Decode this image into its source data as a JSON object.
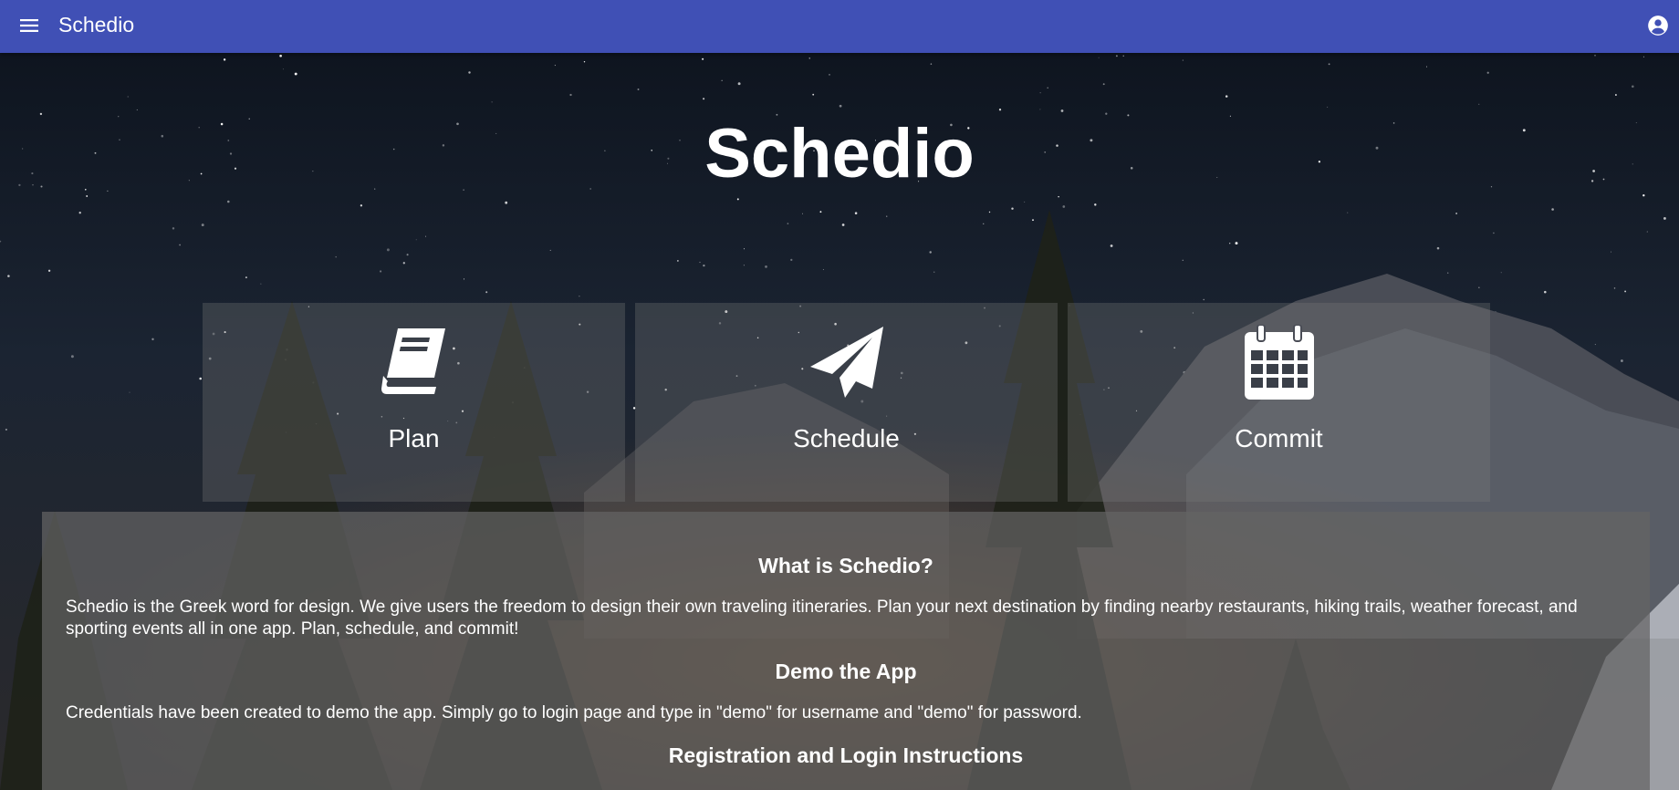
{
  "appbar": {
    "title": "Schedio",
    "menu_icon": "menu-icon",
    "account_icon": "account-circle-icon",
    "color": "#4050b5"
  },
  "hero": {
    "title": "Schedio"
  },
  "features": [
    {
      "label": "Plan",
      "icon": "book-icon"
    },
    {
      "label": "Schedule",
      "icon": "paper-plane-icon"
    },
    {
      "label": "Commit",
      "icon": "calendar-icon"
    }
  ],
  "info": {
    "sections": [
      {
        "heading": "What is Schedio?",
        "text": "Schedio is the Greek word for design. We give users the freedom to design their own traveling itineraries. Plan your next destination by finding nearby restaurants, hiking trails, weather forecast, and sporting events all in one app. Plan, schedule, and commit!"
      },
      {
        "heading": "Demo the App",
        "text": "Credentials have been created to demo the app. Simply go to login page and type in \"demo\" for username and \"demo\" for password."
      },
      {
        "heading": "Registration and Login Instructions",
        "text": ""
      }
    ]
  }
}
